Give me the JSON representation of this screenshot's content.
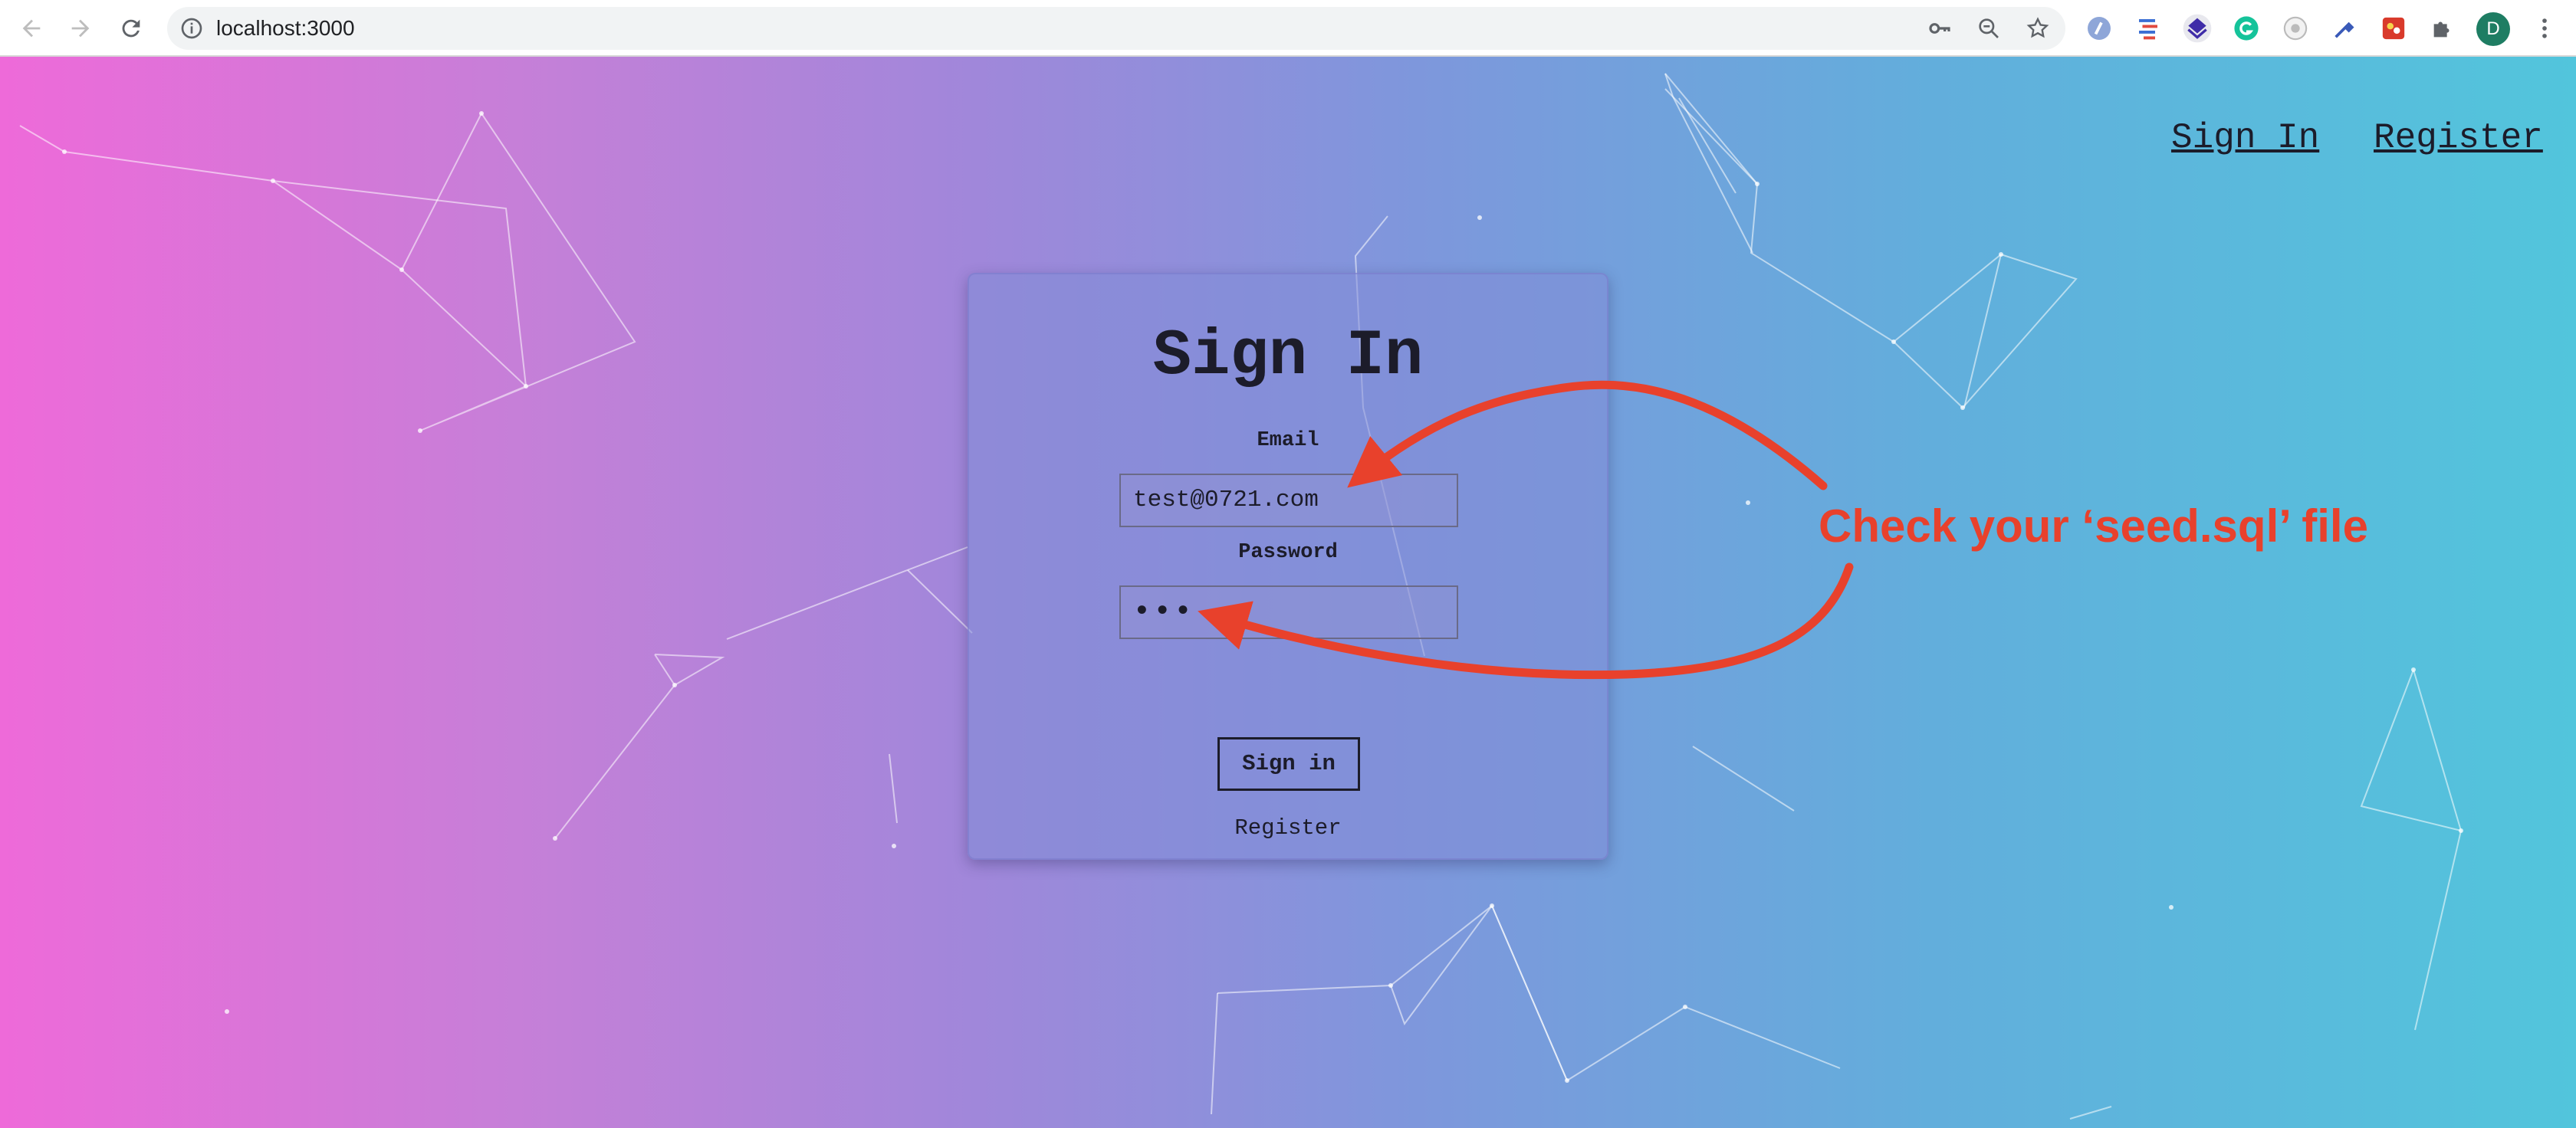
{
  "browser": {
    "url": "localhost:3000",
    "avatar_letter": "D",
    "toolbar_icons": [
      "back-icon",
      "forward-icon",
      "reload-icon",
      "site-info-icon",
      "key-icon",
      "zoom-icon",
      "star-icon"
    ],
    "extension_icons": [
      "extension-1-icon",
      "extension-2-icon",
      "extension-3-icon",
      "grammarly-icon",
      "extension-5-icon",
      "eyedropper-icon",
      "extension-7-icon",
      "puzzle-icon"
    ]
  },
  "nav": {
    "sign_in": "Sign In",
    "register": "Register"
  },
  "form": {
    "title": "Sign In",
    "email_label": "Email",
    "email_value": "test@0721.com",
    "password_label": "Password",
    "password_value": "•••",
    "submit_label": "Sign in",
    "register_link": "Register"
  },
  "annotation": {
    "text": "Check your ‘seed.sql’ file",
    "color": "#e8412c"
  },
  "colors": {
    "gradient_left": "#ee6ad9",
    "gradient_right": "#52c5dc",
    "text": "#1c1c2a"
  }
}
